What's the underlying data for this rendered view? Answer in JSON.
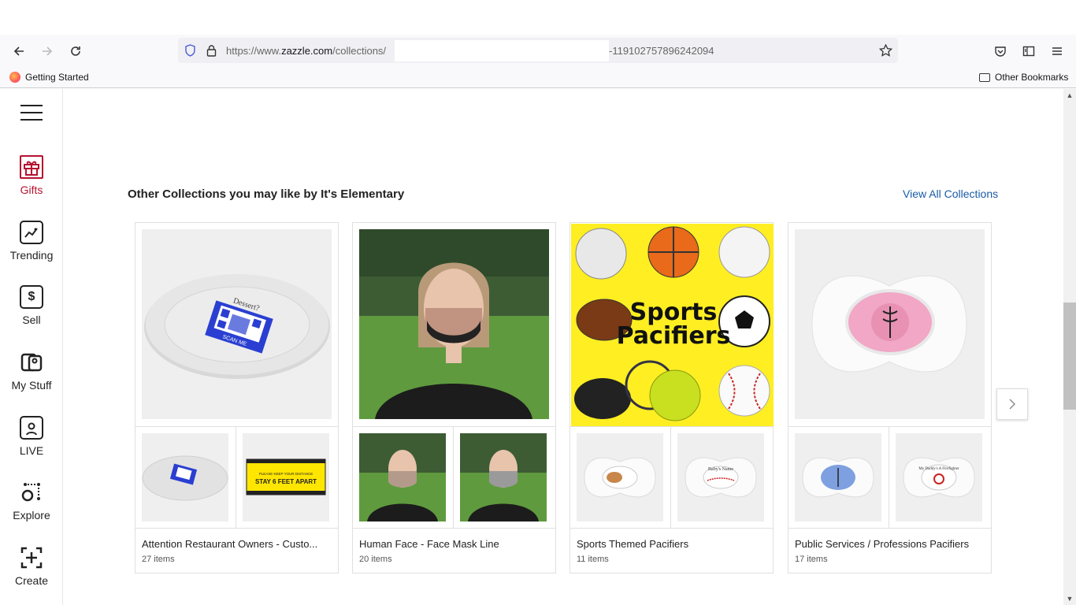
{
  "browser": {
    "url_prefix": "https://www.",
    "url_host": "zazzle.com",
    "url_path": "/collections/",
    "url_tail": "-119102757896242094",
    "bookmark_left": "Getting Started",
    "bookmark_right": "Other Bookmarks"
  },
  "sidebar": {
    "items": [
      {
        "label": "Gifts",
        "icon": "gift-icon"
      },
      {
        "label": "Trending",
        "icon": "trending-icon"
      },
      {
        "label": "Sell",
        "icon": "dollar-icon"
      },
      {
        "label": "My Stuff",
        "icon": "my-stuff-icon"
      },
      {
        "label": "LIVE",
        "icon": "live-icon"
      },
      {
        "label": "Explore",
        "icon": "explore-icon"
      },
      {
        "label": "Create",
        "icon": "create-icon"
      }
    ]
  },
  "section": {
    "title": "Other Collections you may like by It's Elementary",
    "view_all": "View All Collections"
  },
  "collections": [
    {
      "title": "Attention Restaurant Owners - Custo...",
      "count": "27 items"
    },
    {
      "title": "Human Face - Face Mask Line",
      "count": "20 items"
    },
    {
      "title": "Sports Themed Pacifiers",
      "count": "11 items"
    },
    {
      "title": "Public Services / Professions Pacifiers",
      "count": "17 items"
    }
  ],
  "images": {
    "plate_text_top": "Dessert?",
    "plate_text_bottom": "SCAN ME",
    "sign_small": "PLEASE KEEP YOUR DISTANCE",
    "sign_big": "STAY 6 FEET APART",
    "sports_line1": "Sports",
    "sports_line2": "Pacifiers",
    "baby_name": "Baby's Name",
    "daddy_text": "My Daddy's A Firefighter"
  },
  "colors": {
    "accent_red": "#b5122f",
    "link_blue": "#1a5ba6",
    "qr_blue": "#2a3fd1",
    "sports_yellow": "#ffee22"
  }
}
